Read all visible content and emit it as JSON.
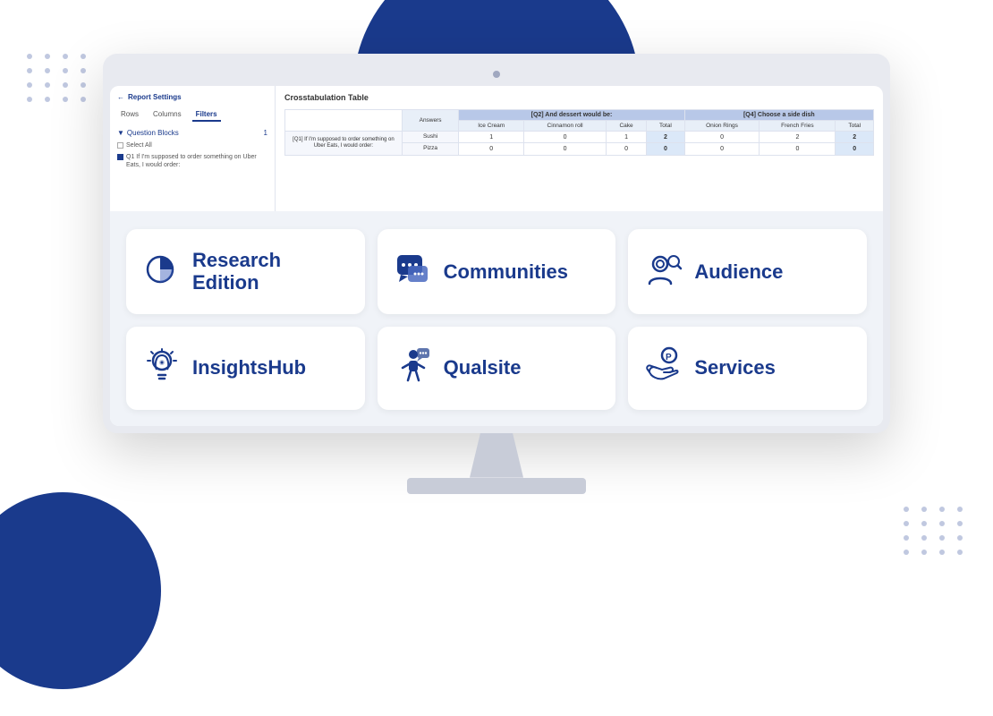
{
  "background": {
    "accent_color": "#1a3a8c",
    "dot_color": "#c0c8e0"
  },
  "monitor": {
    "camera_label": "camera dot"
  },
  "app_ui": {
    "sidebar": {
      "back_label": "Report Settings",
      "tabs": [
        "Rows",
        "Columns",
        "Filters"
      ],
      "active_tab": "Filters",
      "section_label": "Question Blocks",
      "section_count": "1",
      "checkboxes": [
        {
          "checked": false,
          "label": "Select All"
        },
        {
          "checked": true,
          "label": "Q1 If I'm supposed to order something on Uber Eats, I would order:"
        }
      ]
    },
    "content": {
      "title": "Crosstabulation Table",
      "header_group_1": "[Q2] And dessert would be:",
      "header_group_2": "[Q4] Choose a side dish",
      "sub_headers_1": [
        "Ice Cream",
        "Cinnamon roll",
        "Cake",
        "Total"
      ],
      "sub_headers_2": [
        "Onion Rings",
        "French Fries",
        "Total"
      ],
      "row_header": "Answers",
      "rows": [
        {
          "label": "[Q1] If I'm supposed to order something on Uber Eats, I would order:",
          "sub_rows": [
            {
              "label": "Sushi",
              "values_1": [
                "1",
                "0",
                "1",
                "2"
              ],
              "values_2": [
                "0",
                "2",
                "2"
              ]
            },
            {
              "label": "Pizza",
              "values_1": [
                "0",
                "0",
                "0",
                "0"
              ],
              "values_2": [
                "0",
                "0",
                "0"
              ]
            }
          ]
        }
      ]
    }
  },
  "products": {
    "grid": [
      {
        "id": "research-edition",
        "label": "Research\nEdition",
        "icon": "pie-chart-icon"
      },
      {
        "id": "communities",
        "label": "Communities",
        "icon": "chat-bubble-icon"
      },
      {
        "id": "audience",
        "label": "Audience",
        "icon": "person-search-icon"
      },
      {
        "id": "insightshub",
        "label": "InsightsHub",
        "icon": "lightbulb-icon"
      },
      {
        "id": "qualsite",
        "label": "Qualsite",
        "icon": "person-chat-icon"
      },
      {
        "id": "services",
        "label": "Services",
        "icon": "hand-coin-icon"
      }
    ]
  }
}
